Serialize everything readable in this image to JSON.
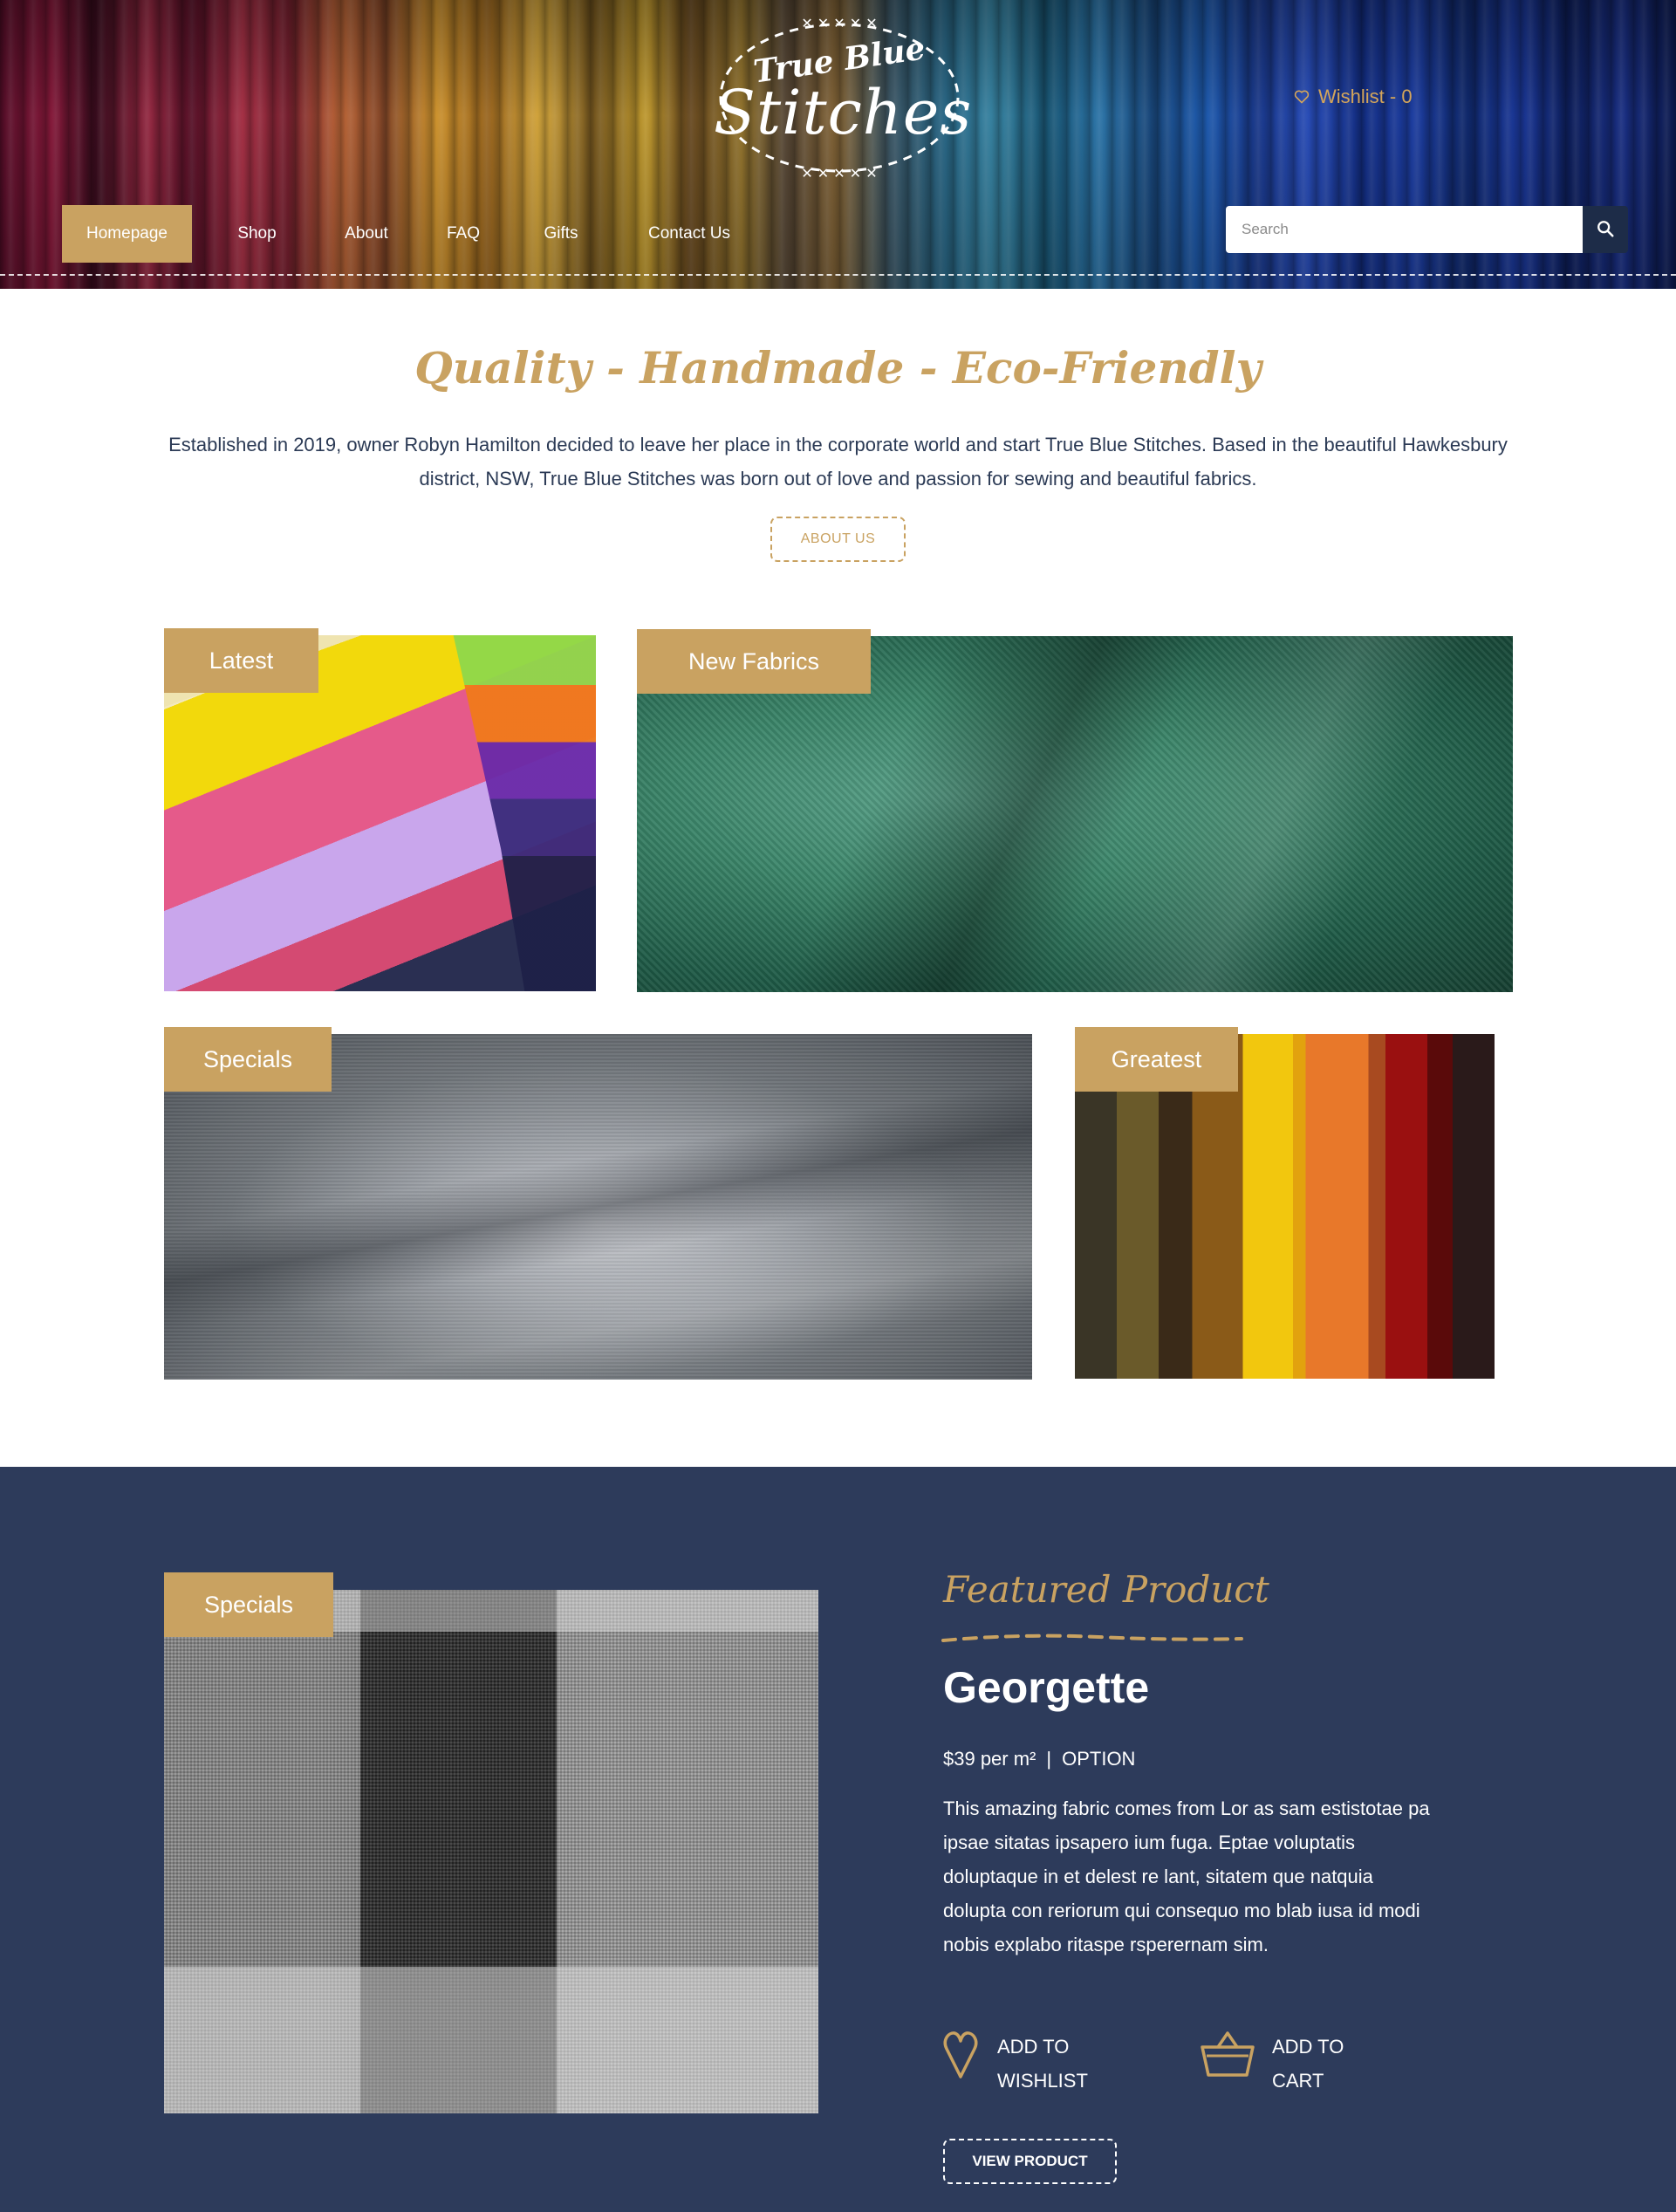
{
  "header": {
    "logo_small": "True Blue",
    "logo_big": "Stitches",
    "wishlist_label": "Wishlist - 0",
    "nav": [
      {
        "label": "Homepage",
        "active": true
      },
      {
        "label": "Shop"
      },
      {
        "label": "About"
      },
      {
        "label": "FAQ"
      },
      {
        "label": "Gifts"
      },
      {
        "label": "Contact Us"
      }
    ],
    "search": {
      "placeholder": "Search"
    }
  },
  "intro": {
    "tagline": "Quality - Handmade - Eco-Friendly",
    "text": "Established in 2019, owner Robyn Hamilton decided to leave her place in the corporate world and start True Blue Stitches. Based in the beautiful Hawkesbury district, NSW, True Blue Stitches was born out of love and passion for sewing and beautiful fabrics.",
    "about_button": "ABOUT US"
  },
  "tiles": [
    {
      "label": "Latest"
    },
    {
      "label": "New Fabrics"
    },
    {
      "label": "Specials"
    },
    {
      "label": "Greatest"
    }
  ],
  "featured": {
    "image_label": "Specials",
    "kicker": "Featured Product",
    "name": "Georgette",
    "price": "$39 per m²",
    "separator": "|",
    "option": "OPTION",
    "description": "This amazing fabric comes from Lor as sam estistotae pa ipsae sitatas ipsapero ium fuga. Eptae voluptatis doluptaque in et delest re lant, sitatem que natquia dolupta con reriorum qui consequo mo blab iusa id modi nobis explabo ritaspe rsperernam sim.",
    "add_to_wishlist": "ADD TO WISHLIST",
    "add_to_cart": "ADD TO CART",
    "view_product": "VIEW PRODUCT"
  },
  "colors": {
    "gold": "#c9a261",
    "navy": "#2d3b5b",
    "text": "#2b3a55"
  },
  "icons": {
    "wishlist": "heart-icon",
    "search": "search-icon",
    "add_to_wishlist": "heart-outline-icon",
    "add_to_cart": "basket-icon"
  }
}
